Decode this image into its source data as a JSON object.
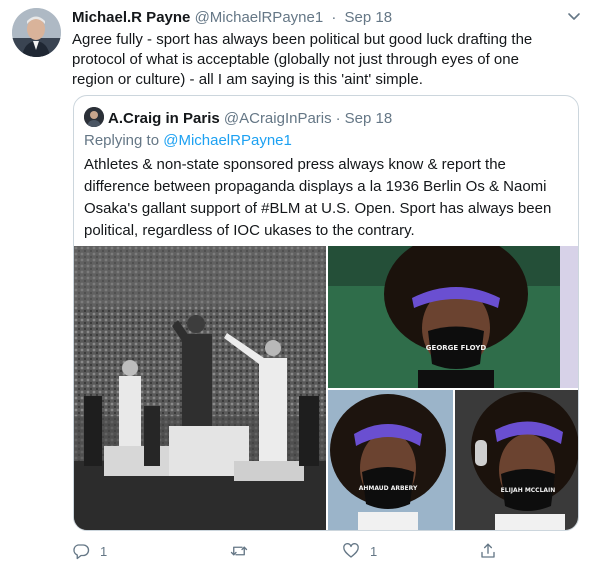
{
  "tweet": {
    "author_name": "Michael.R Payne",
    "author_handle": "@MichaelRPayne1",
    "separator": "·",
    "date": "Sep 18",
    "text_lines": [
      "Agree fully - sport has always been political but good luck drafting the",
      "protocol of what is acceptable (globally not just through eyes of one",
      "region or culture) - all I am saying is this 'aint' simple."
    ]
  },
  "quoted": {
    "author_name": "A.Craig in Paris",
    "author_handle": "@ACraigInParis",
    "separator": "·",
    "date": "Sep 18",
    "reply_prefix": "Replying to ",
    "reply_mention": "@MichaelRPayne1",
    "text_lines": [
      "Athletes & non-state sponsored press always know & report the",
      "difference between propaganda displays a la 1936 Berlin Os & Naomi",
      "Osaka's gallant support of #BLM at U.S. Open. Sport has always been",
      "political, regardless of IOC ukases to the contrary."
    ],
    "mask_text": [
      "GEORGE FLOYD",
      "AHMAUD ARBERY",
      "ELIJAH MCCLAIN"
    ]
  },
  "actions": {
    "reply_count": "1",
    "retweet_count": "",
    "like_count": "1",
    "icons": [
      "reply-icon",
      "retweet-icon",
      "like-icon",
      "share-icon"
    ]
  },
  "colors": {
    "text": "#14171a",
    "secondary": "#657786",
    "accent": "#1da1f2",
    "border": "#ccd6dd"
  }
}
